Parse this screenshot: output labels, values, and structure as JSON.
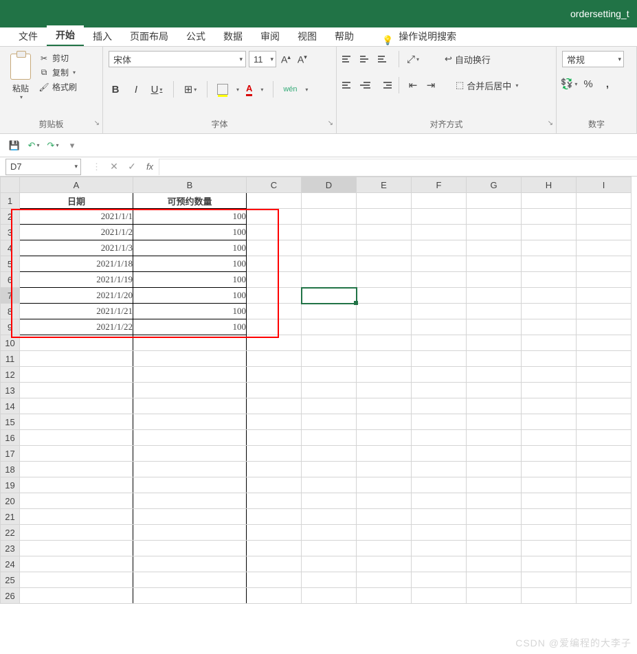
{
  "title": "ordersetting_t",
  "menu": {
    "file": "文件",
    "home": "开始",
    "insert": "插入",
    "layout": "页面布局",
    "formulas": "公式",
    "data": "数据",
    "review": "审阅",
    "view": "视图",
    "help": "帮助",
    "tell": "操作说明搜索"
  },
  "clipboard": {
    "paste": "粘贴",
    "cut": "剪切",
    "copy": "复制",
    "format_painter": "格式刷",
    "group": "剪贴板"
  },
  "font": {
    "name": "宋体",
    "size": "11",
    "group": "字体",
    "bold": "B",
    "italic": "I",
    "underline": "U",
    "wen": "wén"
  },
  "align": {
    "group": "对齐方式",
    "wrap": "自动换行",
    "merge": "合并后居中"
  },
  "number": {
    "group": "数字",
    "format": "常规",
    "percent": "%",
    "comma": ","
  },
  "namebox": "D7",
  "columns": [
    "A",
    "B",
    "C",
    "D",
    "E",
    "F",
    "G",
    "H",
    "I"
  ],
  "headers": {
    "A": "日期",
    "B": "可预约数量"
  },
  "rows": [
    {
      "n": 2,
      "A": "2021/1/1",
      "B": "100"
    },
    {
      "n": 3,
      "A": "2021/1/2",
      "B": "100"
    },
    {
      "n": 4,
      "A": "2021/1/3",
      "B": "100"
    },
    {
      "n": 5,
      "A": "2021/1/18",
      "B": "100"
    },
    {
      "n": 6,
      "A": "2021/1/19",
      "B": "100"
    },
    {
      "n": 7,
      "A": "2021/1/20",
      "B": "100"
    },
    {
      "n": 8,
      "A": "2021/1/21",
      "B": "100"
    },
    {
      "n": 9,
      "A": "2021/1/22",
      "B": "100"
    }
  ],
  "total_rows": 26,
  "selected_cell": "D7",
  "watermark": "CSDN @爱编程的大李子"
}
